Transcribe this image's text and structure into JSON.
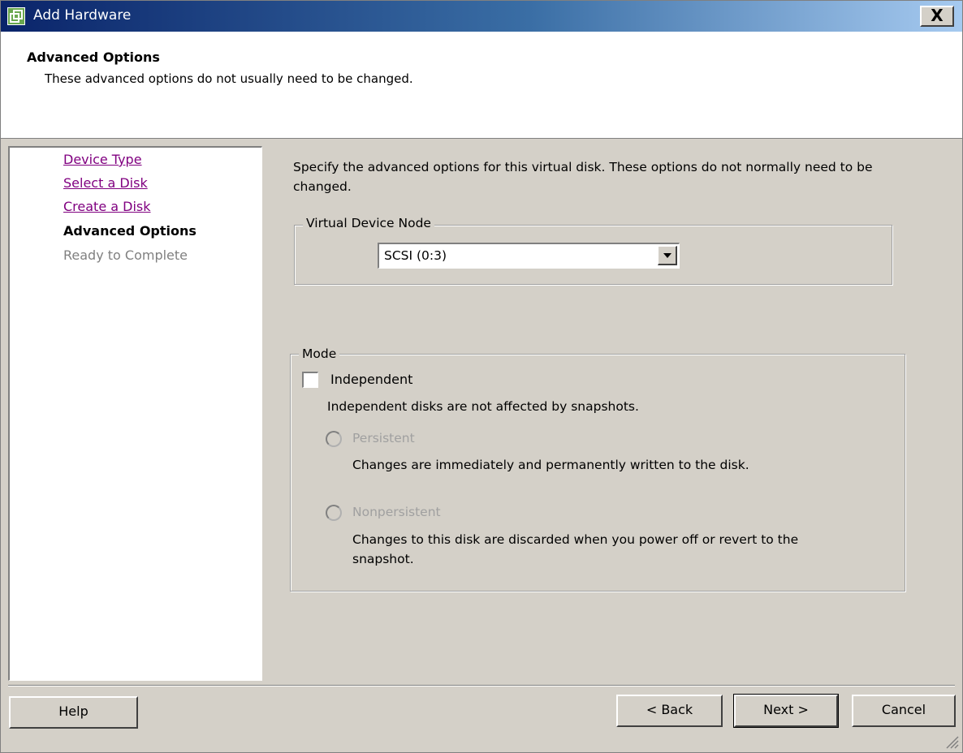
{
  "window": {
    "title": "Add Hardware",
    "close_label": "X"
  },
  "header": {
    "title": "Advanced Options",
    "subtitle": "These advanced options do not usually need to be changed."
  },
  "steps": [
    {
      "label": "Device Type",
      "state": "link"
    },
    {
      "label": "Select a Disk",
      "state": "link"
    },
    {
      "label": "Create a Disk",
      "state": "link"
    },
    {
      "label": "Advanced Options",
      "state": "current"
    },
    {
      "label": "Ready to Complete",
      "state": "disabled"
    }
  ],
  "main": {
    "description": "Specify the advanced options for this virtual disk. These options do not normally need to be changed.",
    "virtual_device_node": {
      "legend": "Virtual Device Node",
      "selected": "SCSI (0:3)"
    },
    "mode": {
      "legend": "Mode",
      "independent_label": "Independent",
      "independent_checked": false,
      "independent_desc": "Independent disks are not affected by snapshots.",
      "persistent_label": "Persistent",
      "persistent_desc": "Changes are immediately and permanently written to the disk.",
      "nonpersistent_label": "Nonpersistent",
      "nonpersistent_desc_line1": "Changes to this disk are discarded when you power off or revert to the",
      "nonpersistent_desc_line2": "snapshot."
    }
  },
  "footer": {
    "help_label": "Help",
    "back_label": "< Back",
    "next_label": "Next >",
    "cancel_label": "Cancel"
  }
}
